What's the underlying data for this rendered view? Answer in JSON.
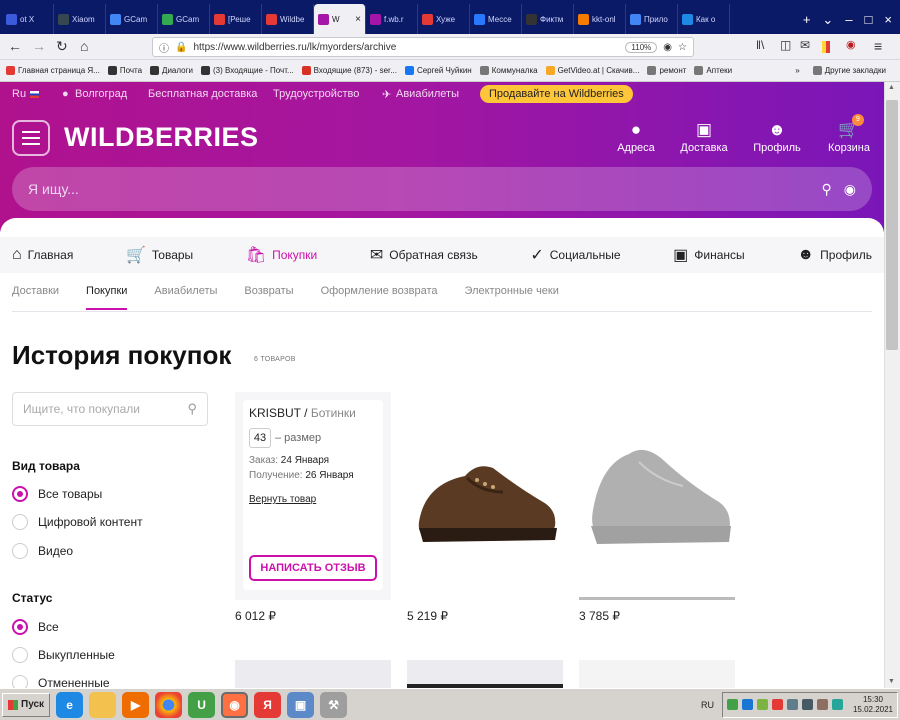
{
  "browser": {
    "tabs": [
      {
        "label": "ot X",
        "color": "#3b5bdb"
      },
      {
        "label": "Xiaom",
        "color": "#37474f"
      },
      {
        "label": "GCam",
        "color": "#4285f4"
      },
      {
        "label": "GCam",
        "color": "#34a853"
      },
      {
        "label": "[Реше",
        "color": "#e53935"
      },
      {
        "label": "Wildbe",
        "color": "#e53935"
      },
      {
        "label": "W",
        "color": "#a516a8",
        "active": true
      },
      {
        "label": "f.wb.r",
        "color": "#a516a8"
      },
      {
        "label": "Хуже",
        "color": "#e53935"
      },
      {
        "label": "Мессе",
        "color": "#2979ff"
      },
      {
        "label": "Фиктм",
        "color": "#333"
      },
      {
        "label": "kkt-onl",
        "color": "#f57c00"
      },
      {
        "label": "Прило",
        "color": "#4285f4"
      },
      {
        "label": "Как о",
        "color": "#1e88e5"
      }
    ],
    "url": "https://www.wildberries.ru/lk/myorders/archive",
    "zoom": "110%",
    "bookmarks": [
      {
        "label": "Главная страница Я...",
        "color": "#e53935"
      },
      {
        "label": "Почта",
        "color": "#333"
      },
      {
        "label": "Диалоги",
        "color": "#333"
      },
      {
        "label": "(3) Входящие - Почт...",
        "color": "#333"
      },
      {
        "label": "Входящие (873) - ser...",
        "color": "#d93025"
      },
      {
        "label": "Сергей Чуйкин",
        "color": "#1877f2"
      },
      {
        "label": "Коммуналка",
        "color": "#777"
      },
      {
        "label": "GetVideo.at | Скачив...",
        "color": "#f9a825"
      },
      {
        "label": "ремонт",
        "color": "#777"
      },
      {
        "label": "Аптеки",
        "color": "#777"
      }
    ],
    "other_bookmarks": "Другие закладки"
  },
  "wb": {
    "lang": "Ru",
    "city": "Волгоград",
    "links": [
      "Бесплатная доставка",
      "Трудоустройство",
      "Авиабилеты"
    ],
    "promo": "Продавайте на Wildberries",
    "logo": "WILDBERRIES",
    "header_icons": [
      {
        "name": "addresses",
        "label": "Адреса",
        "icon": "pin-icon"
      },
      {
        "name": "delivery",
        "label": "Доставка",
        "icon": "box-icon"
      },
      {
        "name": "profile",
        "label": "Профиль",
        "icon": "user-icon"
      },
      {
        "name": "cart",
        "label": "Корзина",
        "icon": "cart-icon"
      }
    ],
    "cart_count": "9",
    "search_placeholder": "Я ищу...",
    "main_nav": [
      {
        "label": "Главная",
        "icon": "home-icon"
      },
      {
        "label": "Товары",
        "icon": "cart-icon"
      },
      {
        "label": "Покупки",
        "icon": "bag-icon",
        "active": true
      },
      {
        "label": "Обратная связь",
        "icon": "chat-icon"
      },
      {
        "label": "Социальные",
        "icon": "like-icon"
      },
      {
        "label": "Финансы",
        "icon": "wallet-icon"
      },
      {
        "label": "Профиль",
        "icon": "user-icon"
      }
    ],
    "sub_nav": [
      "Доставки",
      "Покупки",
      "Авиабилеты",
      "Возвраты",
      "Оформление возврата",
      "Электронные чеки"
    ],
    "sub_nav_active": "Покупки",
    "page_title": "История покупок",
    "items_count": "6 ТОВАРОВ",
    "filter_placeholder": "Ищите, что покупали",
    "type_filter": {
      "title": "Вид товара",
      "options": [
        "Все товары",
        "Цифровой контент",
        "Видео"
      ],
      "selected": "Все товары"
    },
    "status_filter": {
      "title": "Статус",
      "options": [
        "Все",
        "Выкупленные",
        "Отмененные"
      ],
      "selected": "Все"
    },
    "products": [
      {
        "price": "6 012 ₽",
        "brand": "KRISBUT",
        "name": "Ботинки",
        "size": "43",
        "size_label": "– размер",
        "order_label": "Заказ:",
        "order_date": "24 Января",
        "receive_label": "Получение:",
        "receive_date": "26 Января",
        "return_label": "Вернуть товар",
        "review_label": "НАПИСАТЬ ОТЗЫВ"
      },
      {
        "price": "5 219 ₽"
      },
      {
        "price": "3 785 ₽"
      }
    ],
    "accent": "#cb11ab"
  },
  "taskbar": {
    "start": "Пуск",
    "lang": "RU",
    "time": "15:30",
    "date": "15.02.2021"
  }
}
